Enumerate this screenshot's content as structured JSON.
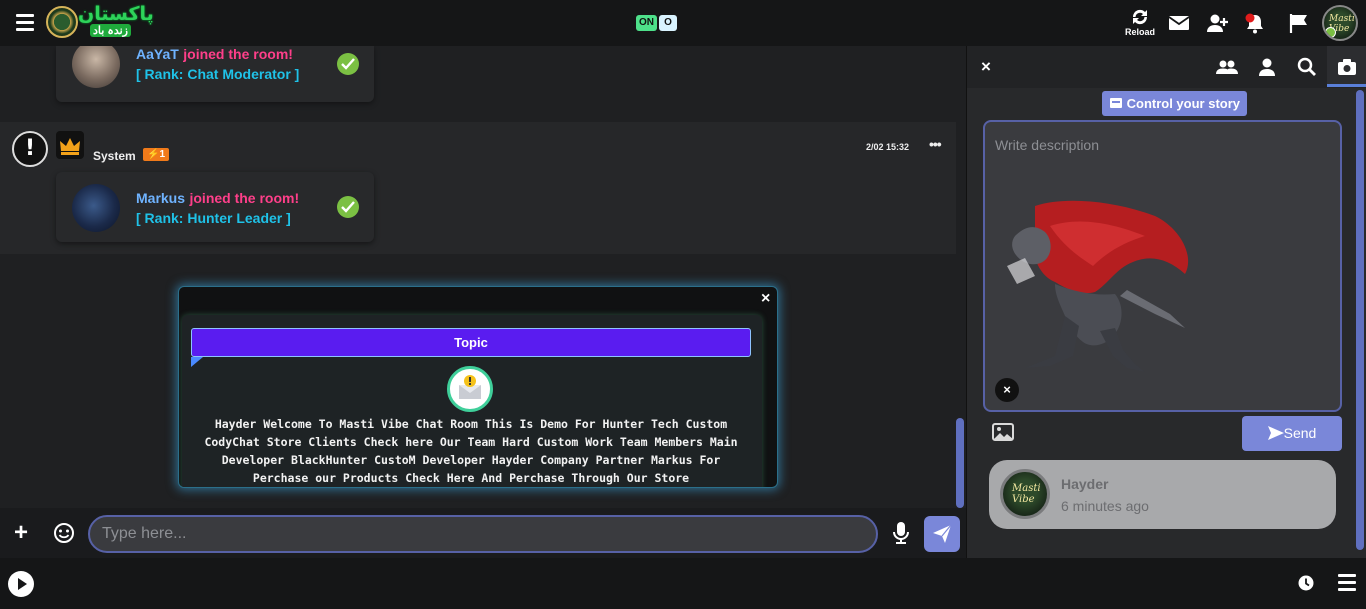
{
  "topbar": {
    "onoff": {
      "on": "ON",
      "off": "O"
    },
    "reload_label": "Reload"
  },
  "messages": [
    {
      "name": "AaYaT",
      "action": "joined the room!",
      "rank": "[ Rank: Chat Moderator ]"
    },
    {
      "name": "Markus",
      "action": "joined the room!",
      "rank": "[ Rank: Hunter Leader ]"
    }
  ],
  "system": {
    "name": "System",
    "badge": "⚡1",
    "time": "2/02 15:32",
    "more": "•••"
  },
  "topic": {
    "title": "Topic",
    "text": "Hayder Welcome To Masti Vibe Chat Room This Is Demo For Hunter Tech Custom CodyChat Store Clients Check here Our Team Hard Custom Work Team Members Main Developer BlackHunter CustoM Developer Hayder Company Partner Markus For Perchase our Products Check Here And Perchase Through Our Store",
    "close": "×"
  },
  "input": {
    "placeholder": "Type here...",
    "plus": "+"
  },
  "panel": {
    "close": "×",
    "story_button": "Control your story",
    "description_placeholder": "Write description",
    "remove": "×",
    "send_label": "Send",
    "story": {
      "name": "Hayder",
      "time": "6 minutes ago"
    }
  },
  "colors": {
    "accent": "#7a87d9",
    "name": "#6fb3ff",
    "joined": "#ff3f8a",
    "rank": "#1fc2e8",
    "check": "#7bc043",
    "topic": "#5a1cf0"
  }
}
